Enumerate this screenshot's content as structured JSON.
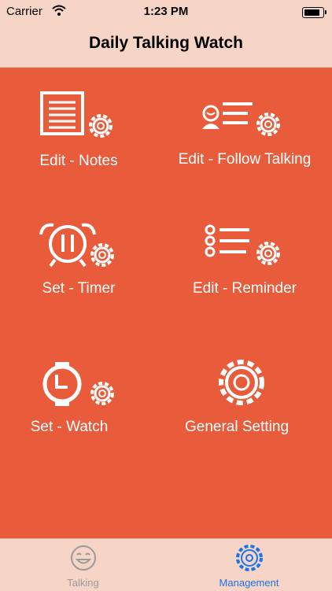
{
  "status_bar": {
    "carrier": "Carrier",
    "time": "1:23 PM",
    "battery_level": 0.85
  },
  "nav": {
    "title": "Daily Talking Watch"
  },
  "tiles": [
    {
      "label": "Edit - Notes",
      "icon": "notes-gear-icon"
    },
    {
      "label": "Edit - Follow Talking",
      "icon": "follow-talking-gear-icon"
    },
    {
      "label": "Set - Timer",
      "icon": "timer-gear-icon"
    },
    {
      "label": "Edit - Reminder",
      "icon": "reminder-gear-icon"
    },
    {
      "label": "Set - Watch",
      "icon": "watch-gear-icon"
    },
    {
      "label": "General Setting",
      "icon": "gear-icon"
    }
  ],
  "tab_bar": {
    "tabs": [
      {
        "label": "Talking",
        "icon": "smiley-icon",
        "active": false
      },
      {
        "label": "Management",
        "icon": "gear-icon",
        "active": true
      }
    ]
  },
  "colors": {
    "background": "#e85c3b",
    "bar": "#f7d5c6",
    "active_tab": "#1a73e8",
    "inactive_tab": "#9a9a9a"
  }
}
